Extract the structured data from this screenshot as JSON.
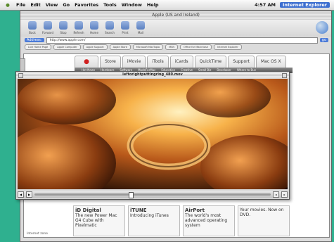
{
  "menubar": {
    "items": [
      "File",
      "Edit",
      "View",
      "Go",
      "Favorites",
      "Tools",
      "Window",
      "Help"
    ],
    "clock": "4:57 AM",
    "app_name": "Internet Explorer"
  },
  "browser": {
    "window_title": "Apple (US and Ireland)",
    "toolbar": [
      "Back",
      "Forward",
      "Stop",
      "Refresh",
      "Home",
      "Search",
      "Print",
      "Mail"
    ],
    "address_label": "Address:",
    "address_value": "http://www.apple.com/",
    "go_label": "go",
    "favorites": [
      "Live Home Page",
      "Apple Computer",
      "Apple Support",
      "Apple Store",
      "Microsoft MacTopia",
      "MSN",
      "Office for Macintosh",
      "Internet Explorer"
    ],
    "status": "Internet zone"
  },
  "site": {
    "tabs": [
      "Store",
      "iMovie",
      "iTools",
      "iCards",
      "QuickTime",
      "Support",
      "Mac OS X"
    ],
    "subnav": [
      "Hot News",
      "Hardware",
      "Software",
      "MadeForMac",
      "Education",
      "Creative",
      "Small Biz",
      "Developer",
      "Where to Buy"
    ],
    "promos": [
      {
        "title": "iD Digital",
        "text": "The new Power Mac G4 Cube with Pixelmatic"
      },
      {
        "title": "iTUNE",
        "text": "Introducing iTunes"
      },
      {
        "title": "AirPort",
        "text": "The world's most advanced operating system"
      },
      {
        "title": "",
        "text": "Your movies. Now on DVD."
      }
    ]
  },
  "video": {
    "title": "leftorightputtingring_480.mov"
  }
}
